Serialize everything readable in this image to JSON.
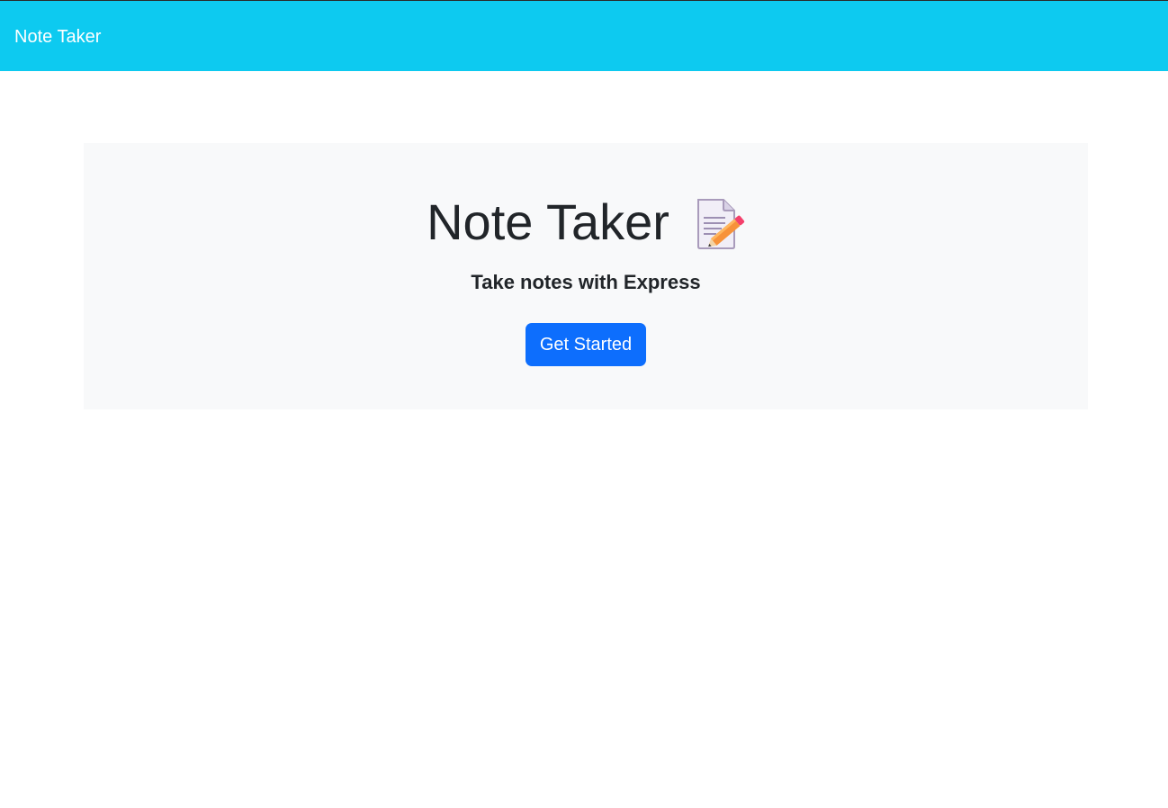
{
  "navbar": {
    "brand": "Note Taker",
    "background_color": "#0dcaf0"
  },
  "hero": {
    "title": "Note Taker",
    "icon": "memo-icon",
    "lead": "Take notes with Express",
    "button_label": "Get Started",
    "button_color": "#0d6efd",
    "background_color": "#f8f9fa"
  }
}
